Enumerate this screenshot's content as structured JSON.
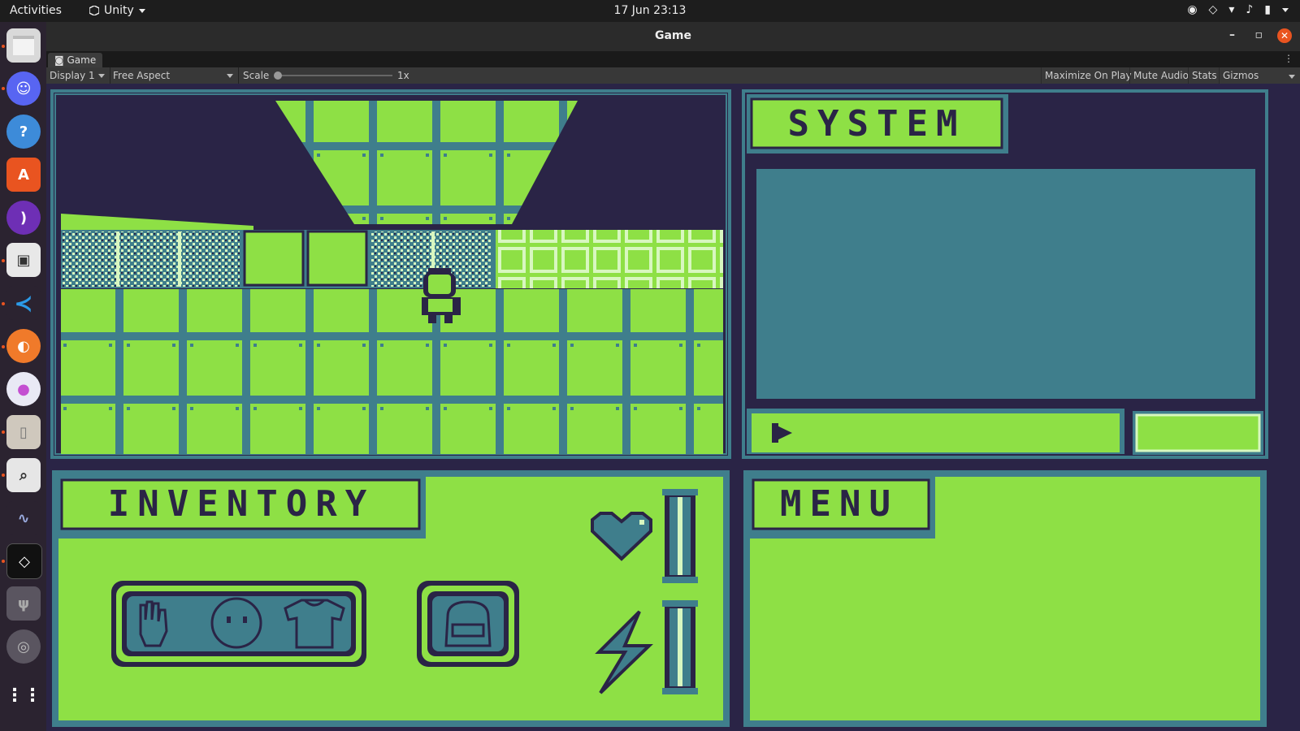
{
  "topbar": {
    "activities": "Activities",
    "app_name": "Unity",
    "clock": "17 Jun  23:13"
  },
  "dock": {
    "items": [
      "files-icon",
      "discord-icon",
      "help-icon",
      "app-center-icon",
      "podcast-icon",
      "twitch-icon",
      "vscode-icon",
      "firefox-icon",
      "krita-icon",
      "archive-icon",
      "screenshot-icon",
      "system-monitor-icon",
      "unity-icon",
      "usb-icon",
      "disc-icon",
      "app-grid-icon"
    ]
  },
  "window": {
    "title": "Game",
    "tab_label": "Game",
    "display": "Display 1",
    "aspect": "Free Aspect",
    "scale_label": "Scale",
    "scale_value": "1x",
    "maximize_on_play": "Maximize On Play",
    "mute_audio": "Mute Audio",
    "stats": "Stats",
    "gizmos": "Gizmos"
  },
  "game": {
    "system_title": "SYSTEM",
    "inventory_title": "INVENTORY",
    "menu_title": "MENU",
    "colors": {
      "light_green": "#8ee045",
      "teal": "#3f7e8c",
      "dark_navy": "#2a2446",
      "pale": "#d8f7c0"
    },
    "health_level": 1.0,
    "energy_level": 1.0,
    "inventory_slots": [
      "hand-icon",
      "face-icon",
      "shirt-icon"
    ],
    "bag_slot": "bag-icon"
  }
}
